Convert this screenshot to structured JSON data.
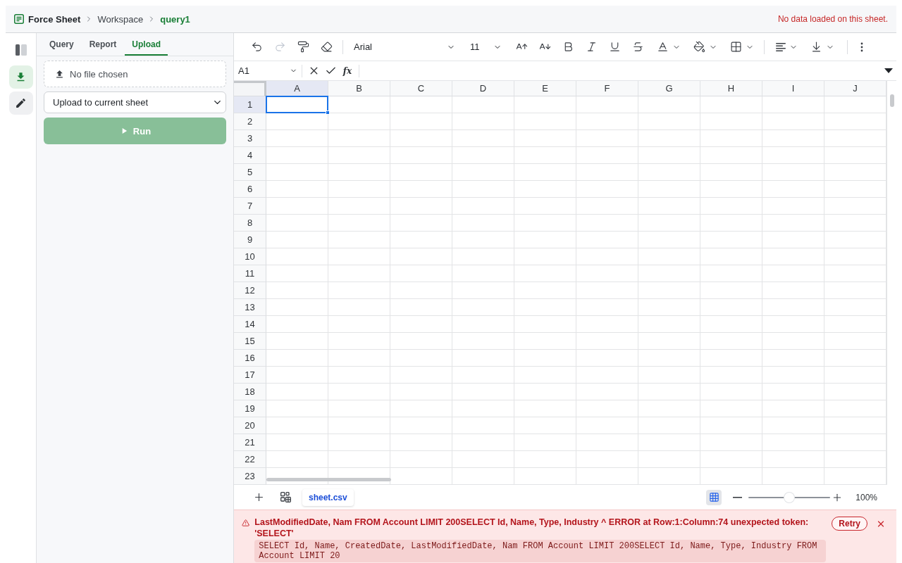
{
  "header": {
    "breadcrumb": [
      {
        "label": "Force Sheet",
        "kind": "app"
      },
      {
        "label": "Workspace",
        "kind": "link"
      },
      {
        "label": "query1",
        "kind": "current"
      }
    ],
    "status": "No data loaded on this sheet."
  },
  "rail": {
    "tools": [
      {
        "kind": "import",
        "selected": true
      },
      {
        "kind": "edit",
        "selected": false
      }
    ]
  },
  "panel": {
    "tabs": [
      {
        "label": "Query",
        "selected": false
      },
      {
        "label": "Report",
        "selected": false
      },
      {
        "label": "Upload",
        "selected": true
      }
    ],
    "file_input": {
      "value": "No file chosen"
    },
    "destination": {
      "value": "Upload to current sheet"
    },
    "run_button": {
      "label": "Run",
      "disabled": true
    }
  },
  "toolbar": {
    "groups": [
      {
        "items": [
          {
            "kind": "undo",
            "disabled": false
          },
          {
            "kind": "redo",
            "disabled": true
          },
          {
            "kind": "format_painter",
            "disabled": false
          },
          {
            "kind": "clear_format",
            "disabled": false
          }
        ]
      },
      {
        "items": [
          {
            "kind": "font",
            "value": "Arial",
            "disabled": false
          },
          {
            "kind": "font_size",
            "value": "11",
            "disabled": false
          },
          {
            "kind": "grow_text",
            "disabled": false
          },
          {
            "kind": "shrink_text",
            "disabled": false
          },
          {
            "kind": "bold",
            "disabled": false
          },
          {
            "kind": "italic",
            "disabled": false
          },
          {
            "kind": "underline",
            "disabled": false
          },
          {
            "kind": "strikethrough",
            "disabled": false
          },
          {
            "kind": "text_color",
            "disabled": false
          },
          {
            "kind": "fill_color",
            "disabled": false
          },
          {
            "kind": "borders",
            "disabled": false
          }
        ]
      },
      {
        "items": [
          {
            "kind": "align",
            "disabled": false
          },
          {
            "kind": "vertical_align",
            "disabled": false
          }
        ]
      },
      {
        "items": [
          {
            "kind": "more",
            "disabled": false
          }
        ]
      }
    ]
  },
  "formula_bar": {
    "cell_ref": "A1",
    "function_label": "fx"
  },
  "grid": {
    "columns": [
      {
        "label": "A",
        "selected": true
      },
      {
        "label": "B",
        "selected": false
      },
      {
        "label": "C",
        "selected": false
      },
      {
        "label": "D",
        "selected": false
      },
      {
        "label": "E",
        "selected": false
      },
      {
        "label": "F",
        "selected": false
      },
      {
        "label": "G",
        "selected": false
      },
      {
        "label": "H",
        "selected": false
      },
      {
        "label": "I",
        "selected": false
      },
      {
        "label": "J",
        "selected": false
      }
    ],
    "rows": [
      {
        "label": "1",
        "selected": true
      },
      {
        "label": "2",
        "selected": false
      },
      {
        "label": "3",
        "selected": false
      },
      {
        "label": "4",
        "selected": false
      },
      {
        "label": "5",
        "selected": false
      },
      {
        "label": "6",
        "selected": false
      },
      {
        "label": "7",
        "selected": false
      },
      {
        "label": "8",
        "selected": false
      },
      {
        "label": "9",
        "selected": false
      },
      {
        "label": "10",
        "selected": false
      },
      {
        "label": "11",
        "selected": false
      },
      {
        "label": "12",
        "selected": false
      },
      {
        "label": "13",
        "selected": false
      },
      {
        "label": "14",
        "selected": false
      },
      {
        "label": "15",
        "selected": false
      },
      {
        "label": "16",
        "selected": false
      },
      {
        "label": "17",
        "selected": false
      },
      {
        "label": "18",
        "selected": false
      },
      {
        "label": "19",
        "selected": false
      },
      {
        "label": "20",
        "selected": false
      },
      {
        "label": "21",
        "selected": false
      },
      {
        "label": "22",
        "selected": false
      },
      {
        "label": "23",
        "selected": false
      }
    ]
  },
  "sheet_bar": {
    "tabs": [
      {
        "label": "sheet.csv",
        "selected": true
      }
    ],
    "grid_lines": {
      "on": true
    },
    "zoom": {
      "level": 0.5,
      "reading": "100%"
    }
  },
  "error": {
    "message": "LastModifiedDate, Nam FROM Account LIMIT 200SELECT Id, Name, Type, Industry ^ ERROR at Row:1:Column:74 unexpected token: 'SELECT'",
    "query": "SELECT Id, Name, CreatedDate, LastModifiedDate, Nam FROM Account LIMIT 200SELECT Id, Name, Type, Industry FROM Account LIMIT 20",
    "retry_label": "Retry"
  }
}
